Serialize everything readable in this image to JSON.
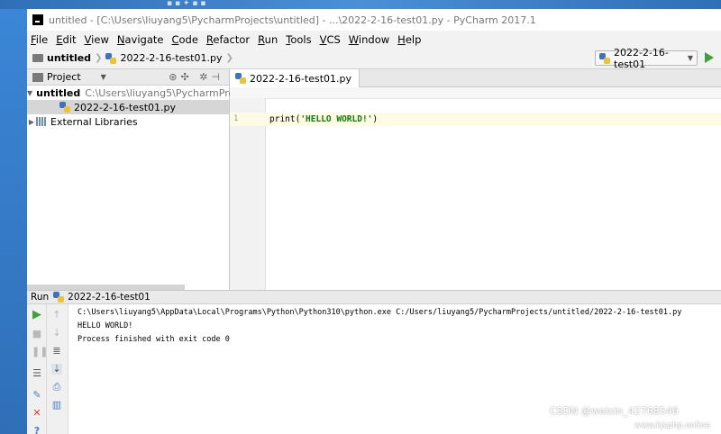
{
  "window": {
    "title": "untitled - [C:\\Users\\liuyang5\\PycharmProjects\\untitled] - ...\\2022-2-16-test01.py - PyCharm 2017.1"
  },
  "menu": [
    "File",
    "Edit",
    "View",
    "Navigate",
    "Code",
    "Refactor",
    "Run",
    "Tools",
    "VCS",
    "Window",
    "Help"
  ],
  "navbar": {
    "project": "untitled",
    "file": "2022-2-16-test01.py",
    "run_config": "2022-2-16-test01"
  },
  "project_panel": {
    "title": "Project",
    "root_name": "untitled",
    "root_path": "C:\\Users\\liuyang5\\PycharmProj",
    "file": "2022-2-16-test01.py",
    "external": "External Libraries"
  },
  "editor": {
    "tab": "2022-2-16-test01.py",
    "line_number": "1",
    "code_prefix": "print(",
    "code_string": "'HELLO WORLD!'",
    "code_suffix": ")"
  },
  "run": {
    "label": "Run",
    "config": "2022-2-16-test01",
    "console": [
      "C:\\Users\\liuyang5\\AppData\\Local\\Programs\\Python\\Python310\\python.exe C:/Users/liuyang5/PycharmProjects/untitled/2022-2-16-test01.py",
      "HELLO WORLD!",
      "",
      "Process finished with exit code 0"
    ]
  },
  "watermark": {
    "text": "CSDN @weixin_42768546",
    "site": "www.kjsphp.online"
  },
  "colors": {
    "run_green": "#3ba33b",
    "stop_red": "#d93a3a",
    "string_green": "#0a7d0a"
  }
}
